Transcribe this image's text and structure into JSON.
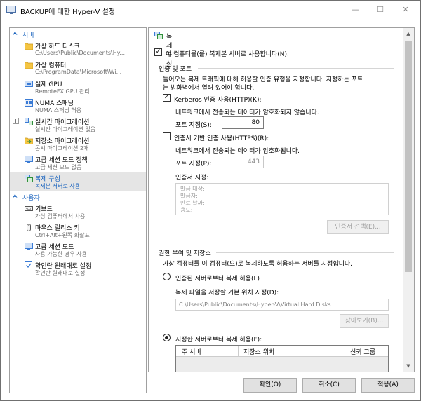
{
  "window": {
    "title": "BACKUP에 대한 Hyper-V 설정"
  },
  "sidebar": {
    "server_header": "서버",
    "user_header": "사용자",
    "server_items": [
      {
        "name": "가상 하드 디스크",
        "sub": "C:\\Users\\Public\\Documents\\Hy...",
        "icon": "folder-icon",
        "icon_color": "#f5c542"
      },
      {
        "name": "가상 컴퓨터",
        "sub": "C:\\ProgramData\\Microsoft\\Wi...",
        "icon": "folder-icon",
        "icon_color": "#f5c542"
      },
      {
        "name": "실제 GPU",
        "sub": "RemoteFX GPU 관리",
        "icon": "gpu-icon",
        "icon_color": "#3a7bd5"
      },
      {
        "name": "NUMA 스패닝",
        "sub": "NUMA 스패닝 허용",
        "icon": "numa-icon",
        "icon_color": "#3a7bd5"
      },
      {
        "name": "실시간 마이그레이션",
        "sub": "실시간 마이그레이션 없음",
        "icon": "migration-icon",
        "icon_color": "#2f8f3b"
      },
      {
        "name": "저장소 마이그레이션",
        "sub": "동시 마이그레이션 2개",
        "icon": "storage-migration-icon",
        "icon_color": "#f5c542"
      },
      {
        "name": "고급 세션 모드 정책",
        "sub": "고급 세션 모드 없음",
        "icon": "session-policy-icon",
        "icon_color": "#3a7bd5"
      },
      {
        "name": "복제 구성",
        "sub": "복제본 서버로 사용",
        "icon": "replication-icon",
        "icon_color": "#2f8f3b"
      }
    ],
    "user_items": [
      {
        "name": "키보드",
        "sub": "가상 컴퓨터에서 사용",
        "icon": "keyboard-icon",
        "icon_color": "#555555"
      },
      {
        "name": "마우스 릴리스 키",
        "sub": "Ctrl+Alt+왼쪽 화살표",
        "icon": "mouse-icon",
        "icon_color": "#555555"
      },
      {
        "name": "고급 세션 모드",
        "sub": "사용 가능한 경우 사용",
        "icon": "session-mode-icon",
        "icon_color": "#3a7bd5"
      },
      {
        "name": "확인란 원래대로 설정",
        "sub": "확인란 원래대로 설정",
        "icon": "reset-checkbox-icon",
        "icon_color": "#3a7bd5"
      }
    ]
  },
  "main": {
    "section_title": "복제 구성",
    "enable_replica_label": "이 컴퓨터를(를) 복제본 서버로 사용합니다(N).",
    "auth_group_label": "인증 및 포트",
    "auth_desc_line1": "들어오는 복제 트래픽에 대해 허용할 인증 유형을 지정합니다. 지정하는 포트",
    "auth_desc_line2": "는 방화벽에서 열려 있어야 합니다.",
    "kerberos_label": "Kerberos 인증 사용(HTTP)(K):",
    "kerberos_note": "네트워크에서 전송되는 데이터가 암호화되지 않습니다.",
    "kerberos_port_label": "포트 지정(S):",
    "kerberos_port_value": "80",
    "cert_label": "인증서 기반 인증 사용(HTTPS)(R):",
    "cert_note": "네트워크에서 전송되는 데이터가 암호화됩니다.",
    "cert_port_label": "포트 지정(P):",
    "cert_port_value": "443",
    "cert_spec_label": "인증서 지정:",
    "cert_fields": [
      "발급 대상:",
      "발급자:",
      "만료 날짜:",
      "용도:"
    ],
    "select_cert_button": "인증서 선택(E)...",
    "authz_group_label": "권한 부여 및 저장소",
    "authz_desc": "가상 컴퓨터를 이 컴퓨터(으)로 복제하도록 허용하는 서버를 지정합니다.",
    "any_server_label": "인증된 서버로부터 복제 허용(L)",
    "default_location_label": "복제 파일을 저장할 기본 위치 지정(D):",
    "default_location_value": "C:\\Users\\Public\\Documents\\Hyper-V\\Virtual Hard Disks",
    "browse_button": "찾아보기(B)...",
    "specified_server_label": "지정한 서버로부터 복제 허용(F):",
    "table_headers": [
      "주 서버",
      "저장소 위치",
      "신뢰 그룹"
    ]
  },
  "footer": {
    "ok": "확인(O)",
    "cancel": "취소(C)",
    "apply": "적용(A)"
  }
}
